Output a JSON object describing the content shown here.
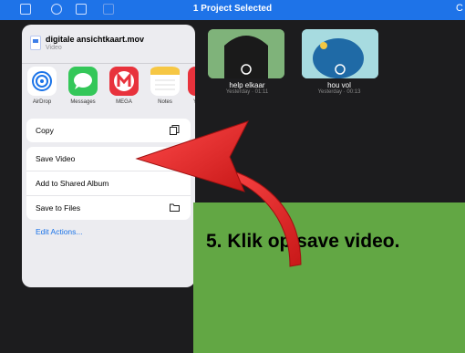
{
  "topbar": {
    "title": "1 Project Selected"
  },
  "projects": [
    {
      "name": "help elkaar",
      "meta": "Yesterday · 01:11"
    },
    {
      "name": "hou vol",
      "meta": "Yesterday · 00:13"
    }
  ],
  "share_sheet": {
    "file_name": "digitale ansichtkaart.mov",
    "file_type": "Video",
    "apps": [
      {
        "label": "AirDrop",
        "icon": "airdrop-icon",
        "color": "#ffffff"
      },
      {
        "label": "Messages",
        "icon": "messages-icon",
        "color": "#34c759"
      },
      {
        "label": "MEGA",
        "icon": "mega-icon",
        "color": "#e8323c"
      },
      {
        "label": "Notes",
        "icon": "notes-icon",
        "color": "#f6c744"
      },
      {
        "label": "Y",
        "icon": "partial-app-icon",
        "color": "#e8323c"
      }
    ],
    "copy_label": "Copy",
    "actions": [
      {
        "label": "Save Video"
      },
      {
        "label": "Add to Shared Album"
      },
      {
        "label": "Save to Files"
      }
    ],
    "edit_actions_label": "Edit Actions..."
  },
  "instruction": {
    "text": "5. Klik op save video."
  },
  "colors": {
    "accent": "#1e73e8",
    "green_panel": "#62a744",
    "arrow": "#e62020"
  }
}
